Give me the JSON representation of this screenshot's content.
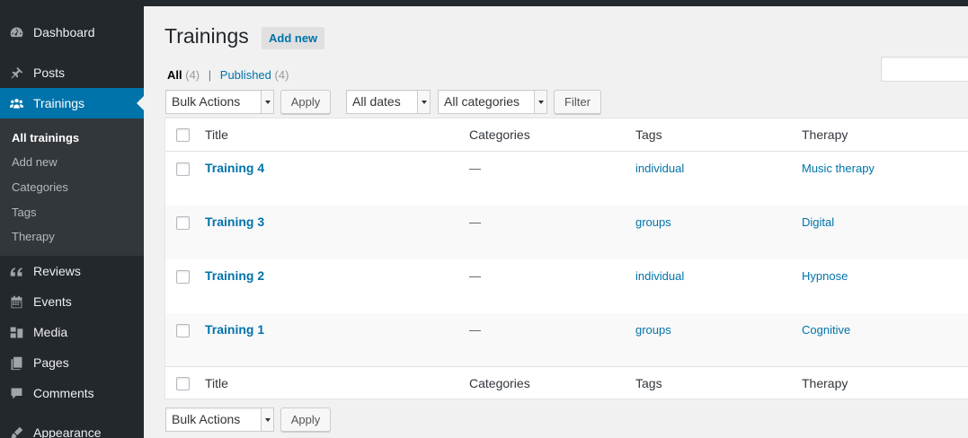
{
  "sidebar": {
    "menu": [
      {
        "label": "Dashboard",
        "icon": "dashboard-icon"
      },
      {
        "label": "Posts",
        "icon": "pin-icon"
      },
      {
        "label": "Trainings",
        "icon": "groups-icon"
      },
      {
        "label": "Reviews",
        "icon": "quote-icon"
      },
      {
        "label": "Events",
        "icon": "calendar-icon"
      },
      {
        "label": "Media",
        "icon": "media-icon"
      },
      {
        "label": "Pages",
        "icon": "pages-icon"
      },
      {
        "label": "Comments",
        "icon": "comment-bubble-icon"
      },
      {
        "label": "Appearance",
        "icon": "brush-icon"
      }
    ],
    "submenu": [
      "All trainings",
      "Add new",
      "Categories",
      "Tags",
      "Therapy"
    ]
  },
  "header": {
    "title": "Trainings",
    "add_new": "Add new"
  },
  "filters": {
    "all_label": "All",
    "all_count": "(4)",
    "separator": "|",
    "published_label": "Published",
    "published_count": "(4)",
    "bulk_actions": "Bulk Actions",
    "apply": "Apply",
    "dates": "All dates",
    "categories": "All categories",
    "filter": "Filter"
  },
  "table": {
    "columns": [
      "Title",
      "Categories",
      "Tags",
      "Therapy"
    ],
    "rows": [
      {
        "title": "Training 4",
        "categories": "—",
        "tags": "individual",
        "therapy": "Music therapy"
      },
      {
        "title": "Training 3",
        "categories": "—",
        "tags": "groups",
        "therapy": "Digital"
      },
      {
        "title": "Training 2",
        "categories": "—",
        "tags": "individual",
        "therapy": "Hypnose"
      },
      {
        "title": "Training 1",
        "categories": "—",
        "tags": "groups",
        "therapy": "Cognitive"
      }
    ]
  },
  "colors": {
    "sidebar_bg": "#23282d",
    "active_menu": "#0073aa",
    "link": "#0073aa",
    "page_bg": "#f1f1f1"
  }
}
